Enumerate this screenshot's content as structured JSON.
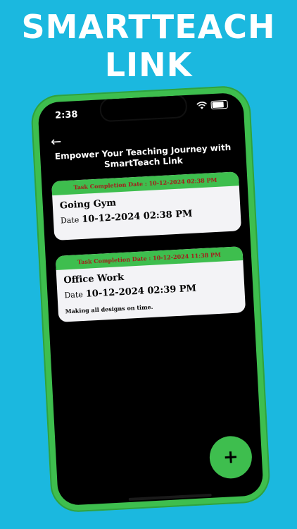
{
  "promo": {
    "line1": "SMARTTEACH",
    "line2": "LINK"
  },
  "status": {
    "time": "2:38"
  },
  "page": {
    "title": "Empower Your Teaching Journey with SmartTeach Link"
  },
  "tasks": [
    {
      "completion": "Task Completion Date : 10-12-2024 02:38 PM",
      "title": "Going Gym",
      "date_label": "Date",
      "date_value": "10-12-2024 02:38 PM",
      "description": ""
    },
    {
      "completion": "Task Completion Date : 10-12-2024 11:38 PM",
      "title": "Office Work",
      "date_label": "Date",
      "date_value": "10-12-2024 02:39 PM",
      "description": "Making all designs on time."
    }
  ],
  "fab": {
    "icon": "plus-icon",
    "label": "+"
  },
  "icons": {
    "back": "arrow-left-icon",
    "wifi": "wifi-icon",
    "battery": "battery-icon"
  },
  "colors": {
    "background": "#1bb8df",
    "accent": "#3ebe4e",
    "completion_text": "#a51b1b"
  }
}
